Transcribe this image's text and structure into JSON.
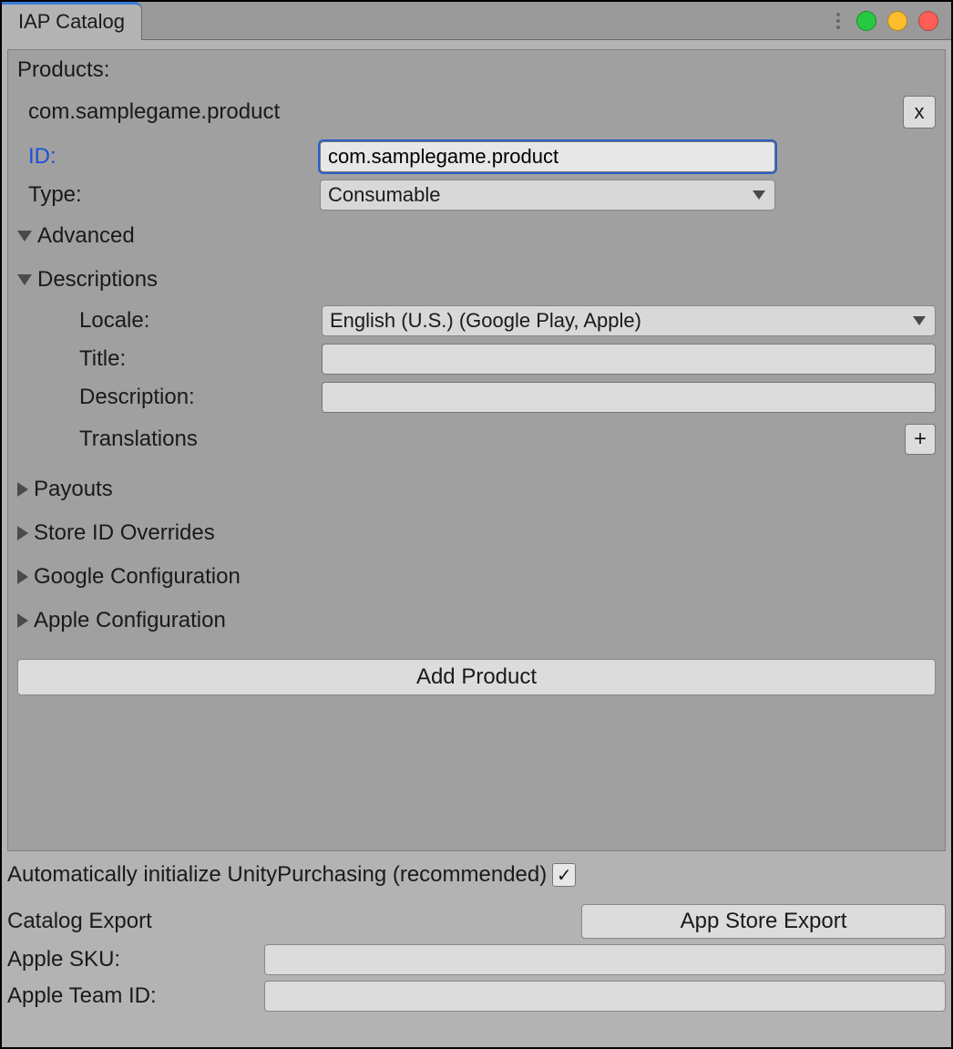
{
  "tab": {
    "title": "IAP Catalog"
  },
  "products": {
    "heading": "Products:",
    "item": {
      "name": "com.samplegame.product",
      "remove_label": "x",
      "id_label": "ID:",
      "id_value": "com.samplegame.product",
      "type_label": "Type:",
      "type_value": "Consumable",
      "advanced_label": "Advanced",
      "descriptions": {
        "label": "Descriptions",
        "locale_label": "Locale:",
        "locale_value": "English (U.S.) (Google Play, Apple)",
        "title_label": "Title:",
        "title_value": "",
        "description_label": "Description:",
        "description_value": "",
        "translations_label": "Translations",
        "translations_add": "+"
      },
      "payouts_label": "Payouts",
      "store_overrides_label": "Store ID Overrides",
      "google_config_label": "Google Configuration",
      "apple_config_label": "Apple Configuration"
    },
    "add_button": "Add Product"
  },
  "footer": {
    "auto_init_label": "Automatically initialize UnityPurchasing (recommended)",
    "auto_init_checked": "✓",
    "catalog_export_label": "Catalog Export",
    "export_button": "App Store Export",
    "apple_sku_label": "Apple SKU:",
    "apple_sku_value": "",
    "apple_team_label": "Apple Team ID:",
    "apple_team_value": ""
  }
}
